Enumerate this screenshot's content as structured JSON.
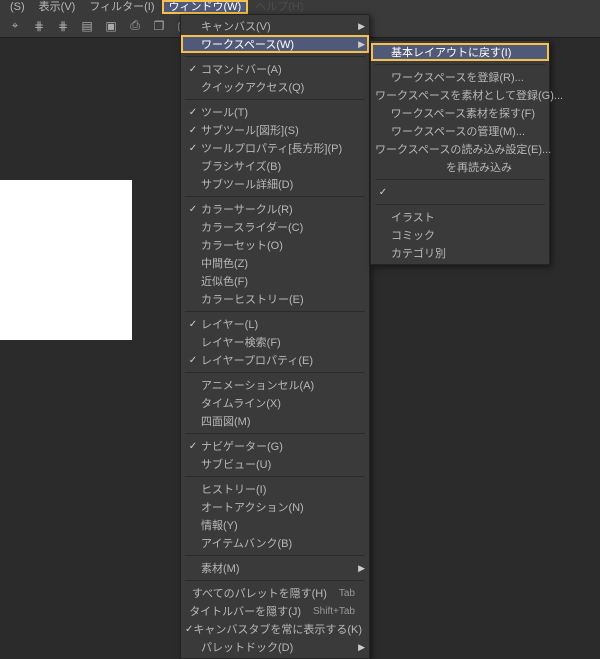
{
  "menubar": {
    "items": [
      {
        "label": "(S)"
      },
      {
        "label": "表示(V)"
      },
      {
        "label": "フィルター(I)"
      },
      {
        "label": "ウィンドウ(W)",
        "active": true
      },
      {
        "label": "ヘルプ(H)",
        "partial": true
      }
    ]
  },
  "main_menu": {
    "items": [
      {
        "label": "キャンバス(V)",
        "arrow": true
      },
      {
        "label": "ワークスペース(W)",
        "arrow": true,
        "highlighted": true,
        "boxed": true
      },
      {
        "sep": true
      },
      {
        "label": "コマンドバー(A)",
        "checked": true
      },
      {
        "label": "クイックアクセス(Q)"
      },
      {
        "sep": true
      },
      {
        "label": "ツール(T)",
        "checked": true
      },
      {
        "label": "サブツール[図形](S)",
        "checked": true
      },
      {
        "label": "ツールプロパティ[長方形](P)",
        "checked": true
      },
      {
        "label": "ブラシサイズ(B)"
      },
      {
        "label": "サブツール詳細(D)"
      },
      {
        "sep": true
      },
      {
        "label": "カラーサークル(R)",
        "checked": true
      },
      {
        "label": "カラースライダー(C)"
      },
      {
        "label": "カラーセット(O)"
      },
      {
        "label": "中間色(Z)"
      },
      {
        "label": "近似色(F)"
      },
      {
        "label": "カラーヒストリー(E)"
      },
      {
        "sep": true
      },
      {
        "label": "レイヤー(L)",
        "checked": true
      },
      {
        "label": "レイヤー検索(F)"
      },
      {
        "label": "レイヤープロパティ(E)",
        "checked": true
      },
      {
        "sep": true
      },
      {
        "label": "アニメーションセル(A)"
      },
      {
        "label": "タイムライン(X)"
      },
      {
        "label": "四面図(M)"
      },
      {
        "sep": true
      },
      {
        "label": "ナビゲーター(G)",
        "checked": true
      },
      {
        "label": "サブビュー(U)"
      },
      {
        "sep": true
      },
      {
        "label": "ヒストリー(I)"
      },
      {
        "label": "オートアクション(N)"
      },
      {
        "label": "情報(Y)"
      },
      {
        "label": "アイテムバンク(B)"
      },
      {
        "sep": true
      },
      {
        "label": "素材(M)",
        "arrow": true
      },
      {
        "sep": true
      },
      {
        "label": "すべてのパレットを隠す(H)",
        "shortcut": "Tab"
      },
      {
        "label": "タイトルバーを隠す(J)",
        "shortcut": "Shift+Tab"
      },
      {
        "label": "キャンバスタブを常に表示する(K)",
        "checked": true
      },
      {
        "label": "パレットドック(D)",
        "arrow": true
      }
    ]
  },
  "sub_menu": {
    "items": [
      {
        "label": "基本レイアウトに戻す(I)",
        "highlighted": true,
        "boxed": true
      },
      {
        "sep": true
      },
      {
        "label": "ワークスペースを登録(R)..."
      },
      {
        "label": "ワークスペースを素材として登録(G)..."
      },
      {
        "label": "ワークスペース素材を探す(F)"
      },
      {
        "label": "ワークスペースの管理(M)..."
      },
      {
        "label": "ワークスペースの読み込み設定(E)..."
      },
      {
        "label": "　　　　　を再読み込み",
        "blur_prefix": true
      },
      {
        "sep": true
      },
      {
        "label": "　　　　",
        "checked": true,
        "blur": true
      },
      {
        "sep": true
      },
      {
        "label": "イラスト"
      },
      {
        "label": "コミック"
      },
      {
        "label": "カテゴリ別"
      }
    ]
  }
}
